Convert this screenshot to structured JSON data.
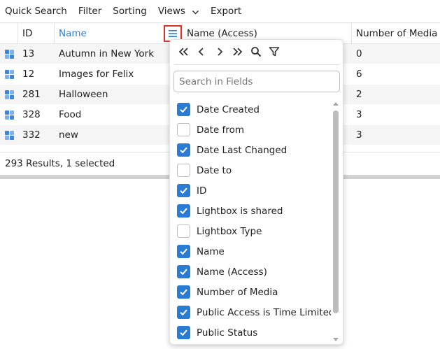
{
  "toolbar": {
    "quick_search": "Quick Search",
    "filter": "Filter",
    "sorting": "Sorting",
    "views": "Views",
    "export": "Export"
  },
  "grid": {
    "headers": {
      "id": "ID",
      "name": "Name",
      "name_access": "Name (Access)",
      "number_of_media": "Number of Media"
    },
    "rows": [
      {
        "id": "13",
        "name": "Autumn in New York",
        "media": "0"
      },
      {
        "id": "12",
        "name": "Images for Felix",
        "media": "6"
      },
      {
        "id": "281",
        "name": "Halloween",
        "media": "2"
      },
      {
        "id": "328",
        "name": "Food",
        "media": "3"
      },
      {
        "id": "332",
        "name": "new",
        "media": "3"
      }
    ],
    "footer": "293 Results, 1 selected"
  },
  "field_chooser": {
    "search_placeholder": "Search in Fields",
    "fields": [
      {
        "label": "Date Created",
        "checked": true
      },
      {
        "label": "Date from",
        "checked": false
      },
      {
        "label": "Date Last Changed",
        "checked": true
      },
      {
        "label": "Date to",
        "checked": false
      },
      {
        "label": "ID",
        "checked": true
      },
      {
        "label": "Lightbox is shared",
        "checked": true
      },
      {
        "label": "Lightbox Type",
        "checked": false
      },
      {
        "label": "Name",
        "checked": true
      },
      {
        "label": "Name (Access)",
        "checked": true
      },
      {
        "label": "Number of Media",
        "checked": true
      },
      {
        "label": "Public Access is Time Limited",
        "checked": true
      },
      {
        "label": "Public Status",
        "checked": true
      }
    ]
  },
  "colors": {
    "accent": "#2a7bd4",
    "header_link": "#2b7fd8",
    "highlight_border": "#e0322a"
  },
  "icons": {
    "menu": "hamburger-icon",
    "first": "double-chevron-left-icon",
    "prev": "chevron-left-icon",
    "next": "chevron-right-icon",
    "last": "double-chevron-right-icon",
    "search": "search-icon",
    "filter": "filter-icon"
  }
}
